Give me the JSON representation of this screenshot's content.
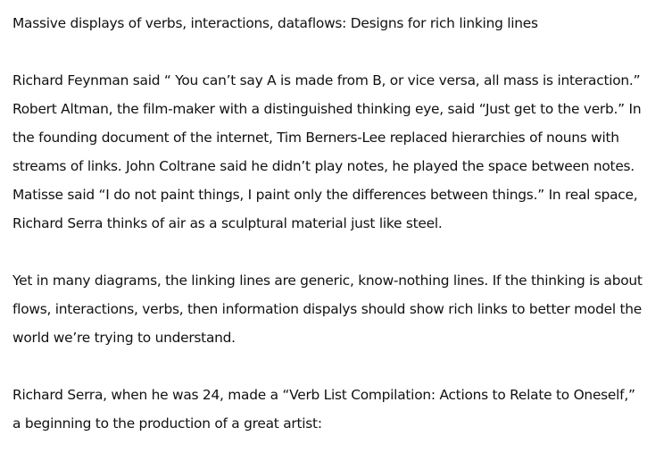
{
  "article": {
    "title": "Massive displays of verbs, interactions, dataflows: Designs for rich linking lines",
    "paragraphs": [
      {
        "lines": [
          "Richard Feynman said “ You can’t say A is made from B, or vice versa, all mass is interaction.”",
          "Robert Altman, the film-maker with a distinguished thinking eye, said “Just get to the verb.”  In",
          "the founding document of the internet, Tim Berners-Lee replaced hierarchies of nouns with",
          "streams of links. John Coltrane said he didn’t play notes, he played the space between notes.",
          "Matisse said “I do not paint things, I paint only the differences between things.” In real space,",
          "Richard Serra thinks of air as a sculptural material just like steel."
        ]
      },
      {
        "lines": [
          "Yet in many diagrams, the linking lines are generic, know-nothing lines. If the thinking is about",
          "flows, interactions, verbs, then information dispalys should show rich links to better model the",
          "world we’re trying to understand."
        ]
      },
      {
        "lines": [
          "Richard Serra, when he was 24, made a “Verb List Compilation:  Actions to Relate to Oneself,”",
          "a beginning to the production of a great artist:"
        ]
      }
    ]
  }
}
